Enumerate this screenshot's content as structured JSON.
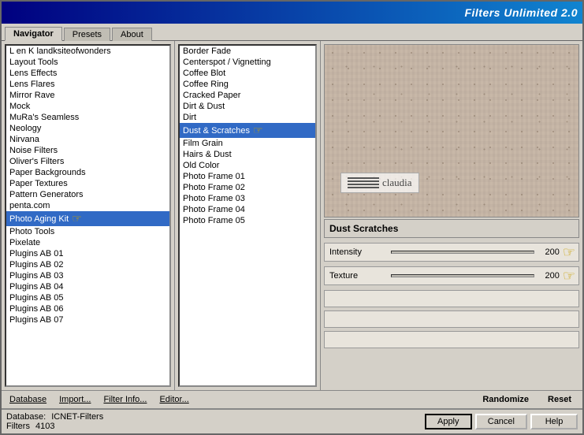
{
  "titleBar": {
    "title": "Filters Unlimited 2.0"
  },
  "tabs": [
    {
      "label": "Navigator",
      "active": true
    },
    {
      "label": "Presets",
      "active": false
    },
    {
      "label": "About",
      "active": false
    }
  ],
  "filterList": {
    "items": [
      {
        "label": "L en K landksiteofwonders",
        "selected": false,
        "hasArrow": false
      },
      {
        "label": "Layout Tools",
        "selected": false,
        "hasArrow": false
      },
      {
        "label": "Lens Effects",
        "selected": false,
        "hasArrow": false
      },
      {
        "label": "Lens Flares",
        "selected": false,
        "hasArrow": false
      },
      {
        "label": "Mirror Rave",
        "selected": false,
        "hasArrow": false
      },
      {
        "label": "Mock",
        "selected": false,
        "hasArrow": false
      },
      {
        "label": "MuRa's Seamless",
        "selected": false,
        "hasArrow": false
      },
      {
        "label": "Neology",
        "selected": false,
        "hasArrow": false
      },
      {
        "label": "Nirvana",
        "selected": false,
        "hasArrow": false
      },
      {
        "label": "Noise Filters",
        "selected": false,
        "hasArrow": false
      },
      {
        "label": "Oliver's Filters",
        "selected": false,
        "hasArrow": false
      },
      {
        "label": "Paper Backgrounds",
        "selected": false,
        "hasArrow": false
      },
      {
        "label": "Paper Textures",
        "selected": false,
        "hasArrow": false
      },
      {
        "label": "Pattern Generators",
        "selected": false,
        "hasArrow": false
      },
      {
        "label": "penta.com",
        "selected": false,
        "hasArrow": false
      },
      {
        "label": "Photo Aging Kit",
        "selected": true,
        "hasArrow": true
      },
      {
        "label": "Photo Tools",
        "selected": false,
        "hasArrow": false
      },
      {
        "label": "Pixelate",
        "selected": false,
        "hasArrow": false
      },
      {
        "label": "Plugins AB 01",
        "selected": false,
        "hasArrow": false
      },
      {
        "label": "Plugins AB 02",
        "selected": false,
        "hasArrow": false
      },
      {
        "label": "Plugins AB 03",
        "selected": false,
        "hasArrow": false
      },
      {
        "label": "Plugins AB 04",
        "selected": false,
        "hasArrow": false
      },
      {
        "label": "Plugins AB 05",
        "selected": false,
        "hasArrow": false
      },
      {
        "label": "Plugins AB 06",
        "selected": false,
        "hasArrow": false
      },
      {
        "label": "Plugins AB 07",
        "selected": false,
        "hasArrow": false
      }
    ]
  },
  "effectList": {
    "items": [
      {
        "label": "Border Fade",
        "selected": false
      },
      {
        "label": "Centerspot / Vignetting",
        "selected": false
      },
      {
        "label": "Coffee Blot",
        "selected": false
      },
      {
        "label": "Coffee Ring",
        "selected": false
      },
      {
        "label": "Cracked Paper",
        "selected": false
      },
      {
        "label": "Dirt & Dust",
        "selected": false
      },
      {
        "label": "Dirt",
        "selected": false
      },
      {
        "label": "Dust & Scratches",
        "selected": true
      },
      {
        "label": "Film Grain",
        "selected": false
      },
      {
        "label": "Hairs & Dust",
        "selected": false
      },
      {
        "label": "Old Color",
        "selected": false
      },
      {
        "label": "Photo Frame 01",
        "selected": false
      },
      {
        "label": "Photo Frame 02",
        "selected": false
      },
      {
        "label": "Photo Frame 03",
        "selected": false
      },
      {
        "label": "Photo Frame 04",
        "selected": false
      },
      {
        "label": "Photo Frame 05",
        "selected": false
      }
    ]
  },
  "preview": {
    "effectName": "Dust  Scratches",
    "watermarkText": "claudia"
  },
  "controls": {
    "intensity": {
      "label": "Intensity",
      "value": 200,
      "max": 200
    },
    "texture": {
      "label": "Texture",
      "value": 200,
      "max": 200
    }
  },
  "bottomToolbar": {
    "database": "Database",
    "import": "Import...",
    "filterInfo": "Filter Info...",
    "editor": "Editor...",
    "randomize": "Randomize",
    "reset": "Reset"
  },
  "statusBar": {
    "databaseLabel": "Database:",
    "databaseValue": "ICNET-Filters",
    "filtersLabel": "Filters",
    "filtersValue": "4103",
    "applyLabel": "Apply",
    "cancelLabel": "Cancel",
    "helpLabel": "Help"
  }
}
